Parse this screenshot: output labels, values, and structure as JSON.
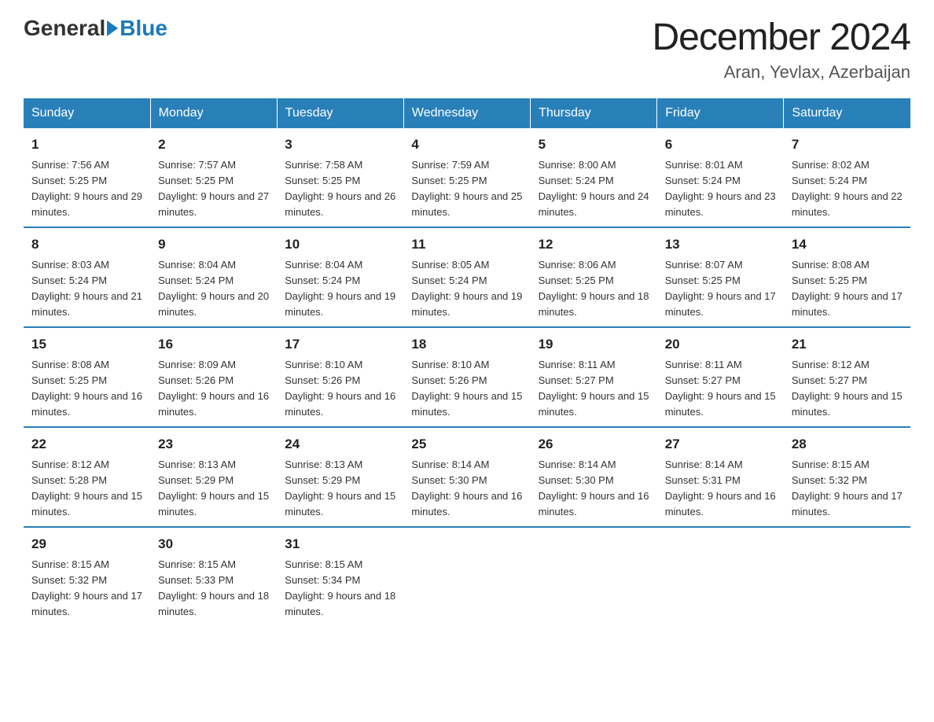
{
  "header": {
    "logo_general": "General",
    "logo_blue": "Blue",
    "month_title": "December 2024",
    "location": "Aran, Yevlax, Azerbaijan"
  },
  "weekdays": [
    "Sunday",
    "Monday",
    "Tuesday",
    "Wednesday",
    "Thursday",
    "Friday",
    "Saturday"
  ],
  "weeks": [
    [
      {
        "day": "1",
        "sunrise": "7:56 AM",
        "sunset": "5:25 PM",
        "daylight": "9 hours and 29 minutes."
      },
      {
        "day": "2",
        "sunrise": "7:57 AM",
        "sunset": "5:25 PM",
        "daylight": "9 hours and 27 minutes."
      },
      {
        "day": "3",
        "sunrise": "7:58 AM",
        "sunset": "5:25 PM",
        "daylight": "9 hours and 26 minutes."
      },
      {
        "day": "4",
        "sunrise": "7:59 AM",
        "sunset": "5:25 PM",
        "daylight": "9 hours and 25 minutes."
      },
      {
        "day": "5",
        "sunrise": "8:00 AM",
        "sunset": "5:24 PM",
        "daylight": "9 hours and 24 minutes."
      },
      {
        "day": "6",
        "sunrise": "8:01 AM",
        "sunset": "5:24 PM",
        "daylight": "9 hours and 23 minutes."
      },
      {
        "day": "7",
        "sunrise": "8:02 AM",
        "sunset": "5:24 PM",
        "daylight": "9 hours and 22 minutes."
      }
    ],
    [
      {
        "day": "8",
        "sunrise": "8:03 AM",
        "sunset": "5:24 PM",
        "daylight": "9 hours and 21 minutes."
      },
      {
        "day": "9",
        "sunrise": "8:04 AM",
        "sunset": "5:24 PM",
        "daylight": "9 hours and 20 minutes."
      },
      {
        "day": "10",
        "sunrise": "8:04 AM",
        "sunset": "5:24 PM",
        "daylight": "9 hours and 19 minutes."
      },
      {
        "day": "11",
        "sunrise": "8:05 AM",
        "sunset": "5:24 PM",
        "daylight": "9 hours and 19 minutes."
      },
      {
        "day": "12",
        "sunrise": "8:06 AM",
        "sunset": "5:25 PM",
        "daylight": "9 hours and 18 minutes."
      },
      {
        "day": "13",
        "sunrise": "8:07 AM",
        "sunset": "5:25 PM",
        "daylight": "9 hours and 17 minutes."
      },
      {
        "day": "14",
        "sunrise": "8:08 AM",
        "sunset": "5:25 PM",
        "daylight": "9 hours and 17 minutes."
      }
    ],
    [
      {
        "day": "15",
        "sunrise": "8:08 AM",
        "sunset": "5:25 PM",
        "daylight": "9 hours and 16 minutes."
      },
      {
        "day": "16",
        "sunrise": "8:09 AM",
        "sunset": "5:26 PM",
        "daylight": "9 hours and 16 minutes."
      },
      {
        "day": "17",
        "sunrise": "8:10 AM",
        "sunset": "5:26 PM",
        "daylight": "9 hours and 16 minutes."
      },
      {
        "day": "18",
        "sunrise": "8:10 AM",
        "sunset": "5:26 PM",
        "daylight": "9 hours and 15 minutes."
      },
      {
        "day": "19",
        "sunrise": "8:11 AM",
        "sunset": "5:27 PM",
        "daylight": "9 hours and 15 minutes."
      },
      {
        "day": "20",
        "sunrise": "8:11 AM",
        "sunset": "5:27 PM",
        "daylight": "9 hours and 15 minutes."
      },
      {
        "day": "21",
        "sunrise": "8:12 AM",
        "sunset": "5:27 PM",
        "daylight": "9 hours and 15 minutes."
      }
    ],
    [
      {
        "day": "22",
        "sunrise": "8:12 AM",
        "sunset": "5:28 PM",
        "daylight": "9 hours and 15 minutes."
      },
      {
        "day": "23",
        "sunrise": "8:13 AM",
        "sunset": "5:29 PM",
        "daylight": "9 hours and 15 minutes."
      },
      {
        "day": "24",
        "sunrise": "8:13 AM",
        "sunset": "5:29 PM",
        "daylight": "9 hours and 15 minutes."
      },
      {
        "day": "25",
        "sunrise": "8:14 AM",
        "sunset": "5:30 PM",
        "daylight": "9 hours and 16 minutes."
      },
      {
        "day": "26",
        "sunrise": "8:14 AM",
        "sunset": "5:30 PM",
        "daylight": "9 hours and 16 minutes."
      },
      {
        "day": "27",
        "sunrise": "8:14 AM",
        "sunset": "5:31 PM",
        "daylight": "9 hours and 16 minutes."
      },
      {
        "day": "28",
        "sunrise": "8:15 AM",
        "sunset": "5:32 PM",
        "daylight": "9 hours and 17 minutes."
      }
    ],
    [
      {
        "day": "29",
        "sunrise": "8:15 AM",
        "sunset": "5:32 PM",
        "daylight": "9 hours and 17 minutes."
      },
      {
        "day": "30",
        "sunrise": "8:15 AM",
        "sunset": "5:33 PM",
        "daylight": "9 hours and 18 minutes."
      },
      {
        "day": "31",
        "sunrise": "8:15 AM",
        "sunset": "5:34 PM",
        "daylight": "9 hours and 18 minutes."
      },
      null,
      null,
      null,
      null
    ]
  ]
}
